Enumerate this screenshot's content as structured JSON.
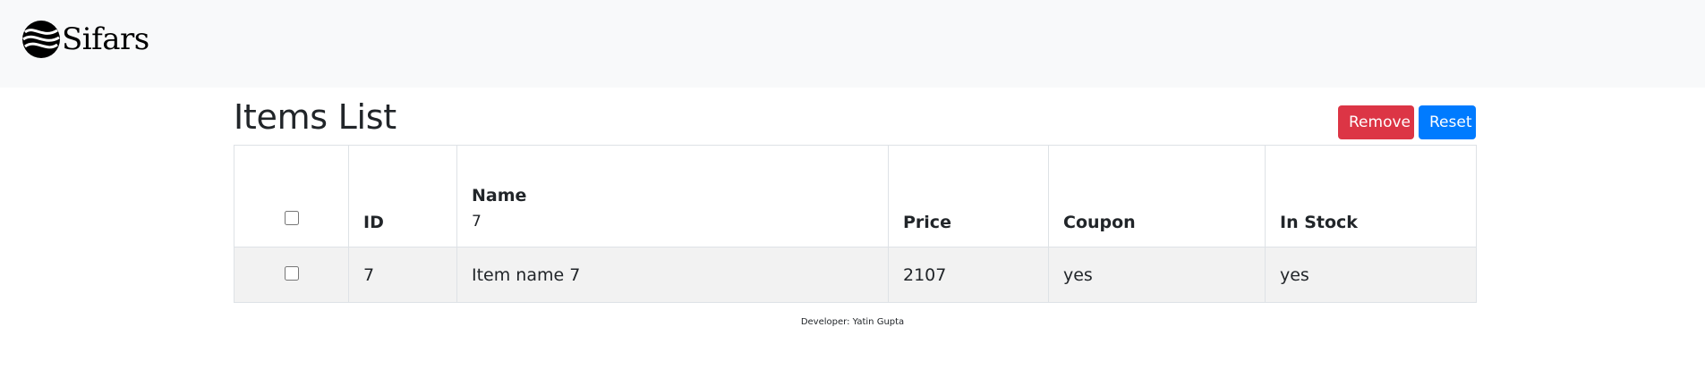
{
  "navbar": {
    "brand_text": "Sifars",
    "logo_icon": "sifars-logo-icon"
  },
  "page": {
    "title": "Items List",
    "remove_label": "Remove",
    "reset_label": "Reset"
  },
  "table": {
    "headers": {
      "id": "ID",
      "name": "Name",
      "price": "Price",
      "coupon": "Coupon",
      "in_stock": "In Stock"
    },
    "name_filter_value": "7",
    "rows": [
      {
        "id": "7",
        "name": "Item name 7",
        "price": "2107",
        "coupon": "yes",
        "in_stock": "yes"
      }
    ]
  },
  "footer": {
    "text": "Developer: Yatin Gupta"
  },
  "colors": {
    "navbar_bg": "#f8f9fa",
    "remove_button": "#dc3545",
    "reset_button": "#007bff",
    "row_bg": "#f2f2f2"
  }
}
